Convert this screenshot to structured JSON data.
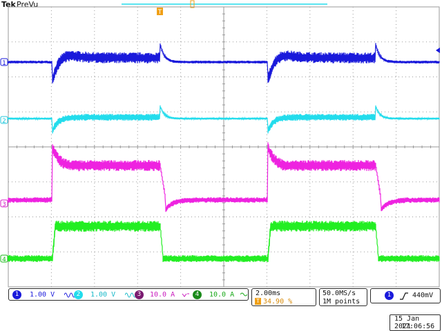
{
  "app": {
    "brand": "Tek",
    "acq_state": "PreVu"
  },
  "colors": {
    "ch1": "#1a1adb",
    "ch2": "#22dcec",
    "ch3": "#ee22e0",
    "ch4": "#22ee22",
    "trigger": "#f0a018",
    "graticule": "#9a9a9a",
    "background": "#ffffff"
  },
  "markers": {
    "ch1": "1",
    "ch2": "2",
    "ch3": "3",
    "ch4": "4",
    "trigger_position_icon": "T-marker-icon",
    "trigger_level_icon": "left-arrow-icon"
  },
  "channels": [
    {
      "id": "1",
      "scale": "1.00 V",
      "bw_icon": "bw-limit-icon"
    },
    {
      "id": "2",
      "scale": "1.00 V",
      "bw_icon": "bw-limit-icon"
    },
    {
      "id": "3",
      "scale": "10.0 A",
      "coupling_icon": "dc-coupling-icon"
    },
    {
      "id": "4",
      "scale": "10.0 A",
      "coupling_icon": "ac-coupling-icon"
    }
  ],
  "timebase": {
    "scale": "2.00ms",
    "trigger_position": "34.90 %"
  },
  "acquisition": {
    "sample_rate": "50.0MS/s",
    "record_length": "1M points"
  },
  "trigger": {
    "source": "1",
    "slope_icon": "rising-edge-icon",
    "level": "440mV"
  },
  "datetime": {
    "date": "15 Jan  2021",
    "time": "17:06:56"
  }
}
